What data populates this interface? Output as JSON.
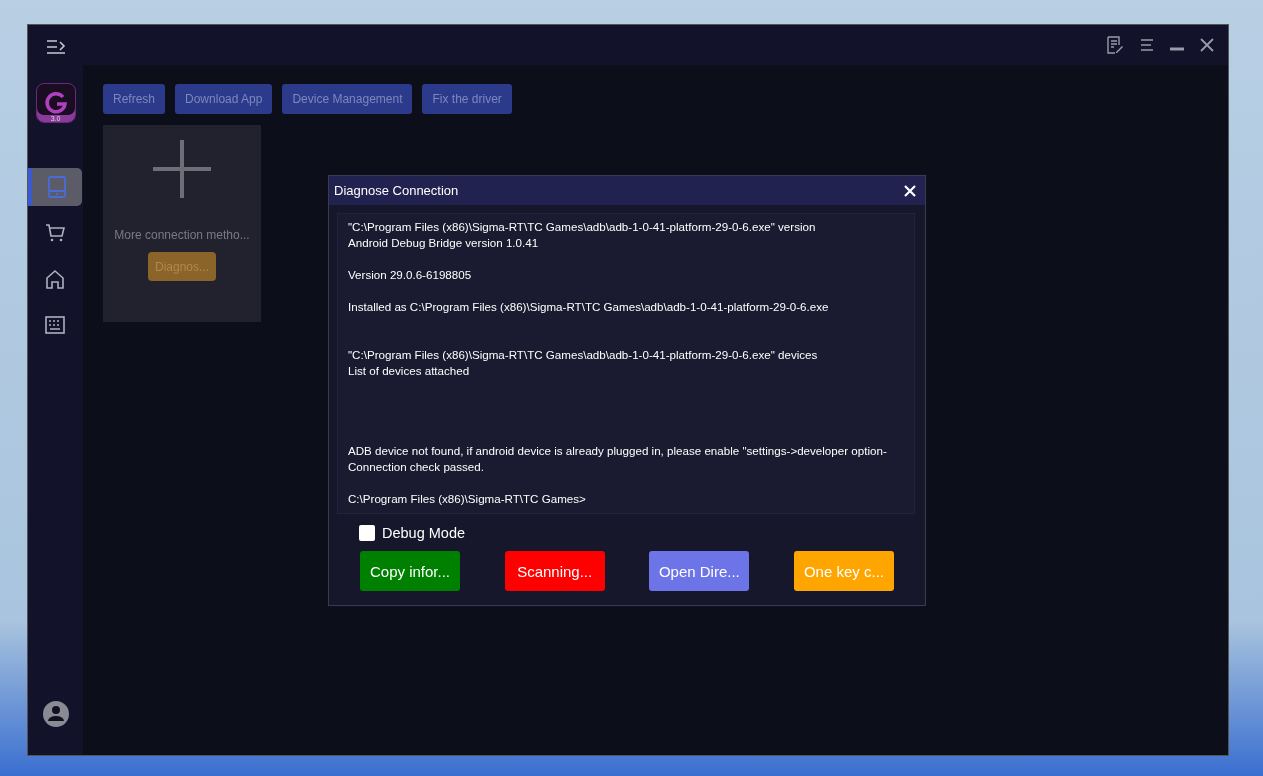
{
  "sidebar": {
    "logo_version": "3.0",
    "items": [
      {
        "kind": "device",
        "selected": true
      },
      {
        "kind": "cart",
        "selected": false
      },
      {
        "kind": "home",
        "selected": false
      },
      {
        "kind": "keyboard",
        "selected": false
      }
    ]
  },
  "toolbar": {
    "buttons": [
      "Refresh",
      "Download App",
      "Device Management",
      "Fix the driver"
    ]
  },
  "connection_card": {
    "label": "More connection metho...",
    "button": "Diagnos..."
  },
  "dialog": {
    "title": "Diagnose Connection",
    "log": [
      {
        "kind": "text",
        "text": "\"C:\\Program Files (x86)\\Sigma-RT\\TC Games\\adb\\adb-1-0-41-platform-29-0-6.exe\" version"
      },
      {
        "kind": "text",
        "text": "Android Debug Bridge version 1.0.41"
      },
      {
        "kind": "blank"
      },
      {
        "kind": "text",
        "text": "Version 29.0.6-6198805"
      },
      {
        "kind": "blank"
      },
      {
        "kind": "text",
        "text": "Installed as C:\\Program Files (x86)\\Sigma-RT\\TC Games\\adb\\adb-1-0-41-platform-29-0-6.exe"
      },
      {
        "kind": "blank"
      },
      {
        "kind": "blank"
      },
      {
        "kind": "text",
        "text": "\"C:\\Program Files (x86)\\Sigma-RT\\TC Games\\adb\\adb-1-0-41-platform-29-0-6.exe\" devices"
      },
      {
        "kind": "text",
        "text": "List of devices attached"
      },
      {
        "kind": "blank"
      },
      {
        "kind": "blank"
      },
      {
        "kind": "blank"
      },
      {
        "kind": "blank"
      },
      {
        "kind": "text",
        "text": "ADB device not found, if android device is already plugged in, please enable \"settings->developer option-"
      },
      {
        "kind": "text",
        "text": "Connection check passed."
      },
      {
        "kind": "blank"
      },
      {
        "kind": "text",
        "text": "C:\\Program Files (x86)\\Sigma-RT\\TC Games>"
      }
    ],
    "debug_mode": {
      "label": "Debug Mode",
      "checked": false
    },
    "buttons": [
      {
        "label": "Copy infor...",
        "color": "#008000"
      },
      {
        "label": "Scanning...",
        "color": "#ff0000"
      },
      {
        "label": "Open Dire...",
        "color": "#6c74e8"
      },
      {
        "label": "One key c...",
        "color": "#ffa500"
      }
    ]
  }
}
